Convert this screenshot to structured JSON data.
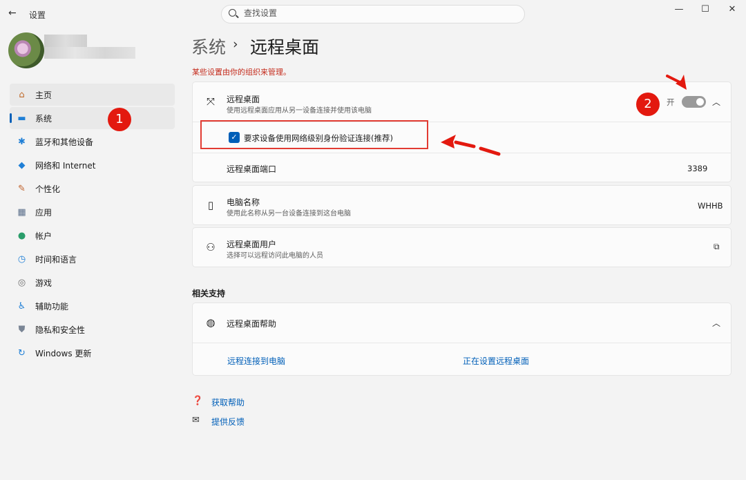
{
  "app": {
    "title": "设置",
    "back_icon": "←"
  },
  "search": {
    "placeholder": "查找设置"
  },
  "window_controls": {
    "minimize": "—",
    "maximize": "☐",
    "close": "✕"
  },
  "breadcrumb": {
    "parent": "系统",
    "separator": "›",
    "current": "远程桌面"
  },
  "notice": "某些设置由你的组织来管理。",
  "nav": {
    "items": [
      {
        "label": "主页",
        "icon": "home-icon",
        "glyph": "⌂"
      },
      {
        "label": "系统",
        "icon": "system-icon",
        "glyph": "▬"
      },
      {
        "label": "蓝牙和其他设备",
        "icon": "bluetooth-icon",
        "glyph": "✱"
      },
      {
        "label": "网络和 Internet",
        "icon": "wifi-icon",
        "glyph": "◆"
      },
      {
        "label": "个性化",
        "icon": "brush-icon",
        "glyph": "✎"
      },
      {
        "label": "应用",
        "icon": "apps-icon",
        "glyph": "▦"
      },
      {
        "label": "帐户",
        "icon": "account-icon",
        "glyph": "●"
      },
      {
        "label": "时间和语言",
        "icon": "time-language-icon",
        "glyph": "◷"
      },
      {
        "label": "游戏",
        "icon": "gaming-icon",
        "glyph": "◎"
      },
      {
        "label": "辅助功能",
        "icon": "accessibility-icon",
        "glyph": "♿"
      },
      {
        "label": "隐私和安全性",
        "icon": "shield-icon",
        "glyph": "⛊"
      },
      {
        "label": "Windows 更新",
        "icon": "update-icon",
        "glyph": "↻"
      }
    ]
  },
  "remote_desktop": {
    "title": "远程桌面",
    "subtitle": "使用远程桌面应用从另一设备连接并使用该电脑",
    "toggle_state": "开",
    "toggle_on": true,
    "nla_label": "要求设备使用网络级别身份验证连接(推荐)",
    "nla_checked": true,
    "port_label": "远程桌面端口",
    "port_value": "3389"
  },
  "pc_name": {
    "title": "电脑名称",
    "subtitle": "使用此名称从另一台设备连接到这台电脑",
    "value": "WHHB"
  },
  "rd_users": {
    "title": "远程桌面用户",
    "subtitle": "选择可以远程访问此电脑的人员"
  },
  "related": {
    "section_title": "相关支持",
    "help_title": "远程桌面帮助",
    "links": [
      "远程连接到电脑",
      "正在设置远程桌面"
    ]
  },
  "footer": {
    "get_help": "获取帮助",
    "feedback": "提供反馈"
  },
  "annotations": {
    "badge1": "1",
    "badge2": "2",
    "arrow_color": "#e3190f"
  },
  "colors": {
    "accent": "#005fb8",
    "warning": "#c42b1c",
    "annotation": "#e3190f"
  }
}
